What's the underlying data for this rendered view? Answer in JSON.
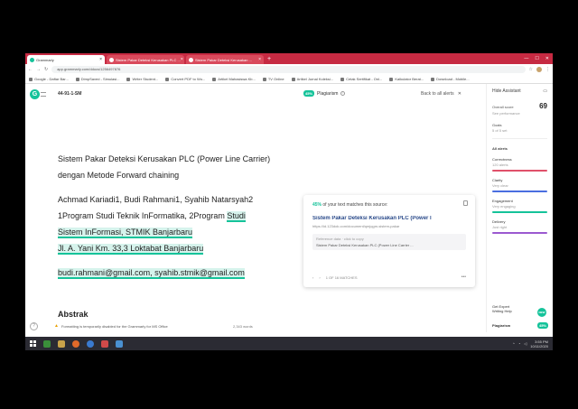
{
  "browser": {
    "tabs": [
      {
        "label": "Grammarly",
        "color": "#15c39a"
      },
      {
        "label": "Sistem Pakar Deteksi Kerusakan PLC ...",
        "color": "#e0506a"
      },
      {
        "label": "Sistem Pakar Deteksi Kerusakan ...",
        "color": "#e0506a"
      }
    ],
    "url": "app.grammarly.com/ddocs/1256497876",
    "bookmarks": [
      "Google - Daftar Bar...",
      "DimpSaved - Simulasi...",
      "Writer Student...",
      "Convert PDF to Wo...",
      "Artikel Mahasiswa Kb...",
      "TV Online",
      "Artikel Jurnal Koleksi...",
      "Cetak Sertifikat - Onl...",
      "Kalkulator Berat...",
      "Download - Mobile..."
    ]
  },
  "header": {
    "doc_name": "44-91-1-SM",
    "plagiarism_pct": "45%",
    "plagiarism_label": "Plagiarism",
    "back_label": "Back to all alerts"
  },
  "document": {
    "title_line1": "Sistem Pakar Deteksi Kerusakan PLC (Power Line Carrier)",
    "title_line2": "dengan Metode Forward chaining",
    "authors": "Achmad Kariadi1, Budi Rahmani1, Syahib Natarsyah2",
    "affil_a": "1Program Studi Teknik InFormatika, 2Program ",
    "affil_hl1": "Studi",
    "affil_hl2": "Sistem InFormasi, STMIK Banjarbaru",
    "address": "Jl. A. Yani Km. 33,3 Loktabat Banjarbaru",
    "emails": "budi.rahmani@gmail.com, syahib.stmik@gmail.com",
    "abstract_heading": "Abstrak"
  },
  "plag_card": {
    "match_pct": "45%",
    "match_text": " of your text matches this source:",
    "source_title": "Sistem Pakar Deteksi Kerusakan PLC (Power l",
    "source_url": "https://id.123dok.com/document/qmjqgm-sistem-pakar",
    "reference_label": "Reference data · click to copy",
    "reference_text": "Sistem Pakar Deteksi Kerusakan PLC (Power Line Carrier ...",
    "pager": "1 OF 16 MATCHES"
  },
  "sidebar": {
    "assistant": "Hide Assistant",
    "overall_label": "Overall score",
    "overall_value": "69",
    "see_performance": "See performance",
    "goals_label": "Goals",
    "goals_value": "5 of 5 set",
    "all_alerts": "All alerts",
    "categories": [
      {
        "name": "Correctness",
        "status": "120 alerts",
        "color": "#e0506a"
      },
      {
        "name": "Clarity",
        "status": "Very clear",
        "color": "#4a6ee0"
      },
      {
        "name": "Engagement",
        "status": "Very engaging",
        "color": "#15c39a"
      },
      {
        "name": "Delivery",
        "status": "Just right",
        "color": "#9b59d0"
      }
    ],
    "expert_line1": "Get Expert",
    "expert_line2": "Writing Help",
    "new_badge": "NEW",
    "plagiarism_label": "Plagiarism",
    "plagiarism_pct": "45%"
  },
  "status": {
    "warning": "Formatting is temporarily disabled for the Grammarly for MS Office",
    "words": "2,343 words"
  },
  "taskbar": {
    "time": "3:55 PM",
    "date": "10/11/2020",
    "apps": [
      "#3a8f3a",
      "#c9a24a",
      "#e06a2a",
      "#3a7ad0",
      "#d04a4a",
      "#4a90d0"
    ]
  }
}
